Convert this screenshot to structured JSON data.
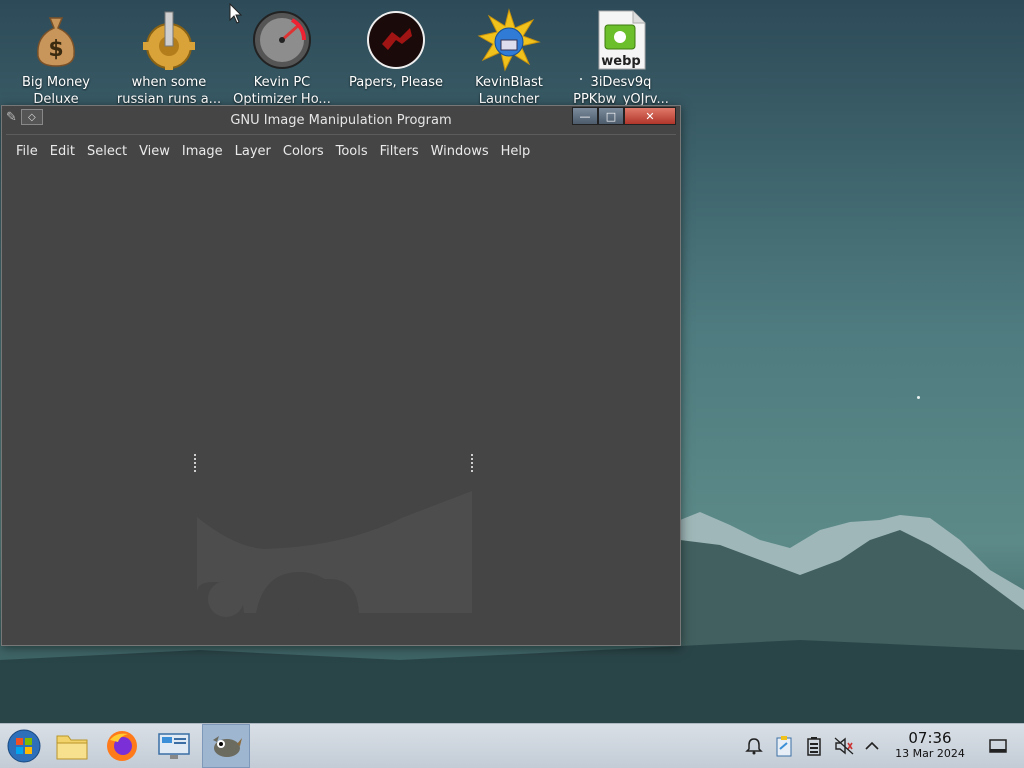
{
  "desktop": {
    "icons": [
      {
        "line1": "Big Money",
        "line2": "Deluxe",
        "icon": "money-bag-icon"
      },
      {
        "line1": "when some",
        "line2": "russian runs a...",
        "icon": "gear-icon"
      },
      {
        "line1": "Kevin PC",
        "line2": "Optimizer Ho...",
        "icon": "speedometer-icon"
      },
      {
        "line1": "Papers, Please",
        "line2": "",
        "icon": "papers-please-icon"
      },
      {
        "line1": "KevinBlast",
        "line2": "Launcher",
        "icon": "globe-burst-icon"
      },
      {
        "line1": "3iDesv9q",
        "line2": "PPKbw_yOJrv...",
        "icon": "webp-file-icon",
        "badge": "webp"
      }
    ]
  },
  "window": {
    "title": "GNU Image Manipulation Program",
    "menu": [
      "File",
      "Edit",
      "Select",
      "View",
      "Image",
      "Layer",
      "Colors",
      "Tools",
      "Filters",
      "Windows",
      "Help"
    ],
    "controls": {
      "minimize": "minimize-icon",
      "maximize": "maximize-icon",
      "close": "close-icon"
    }
  },
  "taskbar": {
    "items": [
      "start-menu",
      "file-manager",
      "firefox",
      "system-settings",
      "gimp"
    ],
    "active": "gimp",
    "tray": [
      "notifications-icon",
      "clipboard-icon",
      "battery-icon",
      "volume-muted-icon",
      "tray-expand-icon"
    ],
    "clock": {
      "time": "07:36",
      "date": "13 Mar 2024"
    }
  },
  "colors": {
    "window_bg": "#454545",
    "taskbar_bg": "#c9d2dc",
    "close_button": "#c9473a"
  }
}
